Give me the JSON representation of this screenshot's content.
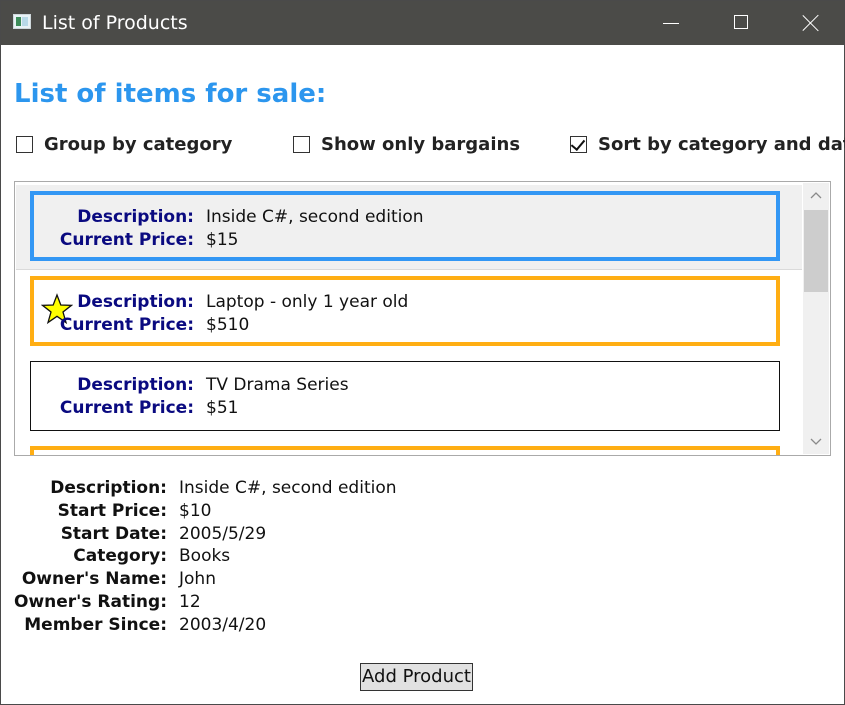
{
  "window": {
    "title": "List of Products",
    "app_icon": "window-app-icon",
    "controls": {
      "minimize": "minimize-icon",
      "maximize": "maximize-icon",
      "close": "close-icon"
    }
  },
  "heading": "List of items for sale:",
  "options": {
    "group_by_category": {
      "label": "Group by category",
      "checked": false
    },
    "show_only_bargains": {
      "label": "Show only bargains",
      "checked": false
    },
    "sort_by_category_date": {
      "label": "Sort by category and date",
      "checked": true
    }
  },
  "list": {
    "description_label": "Description:",
    "price_label": "Current Price:",
    "items": [
      {
        "description": "Inside C#, second edition",
        "price": "$15",
        "style": "selected",
        "bargain": false
      },
      {
        "description": "Laptop - only 1 year old",
        "price": "$510",
        "style": "bargain",
        "bargain": true
      },
      {
        "description": "TV Drama Series",
        "price": "$51",
        "style": "normal",
        "bargain": false
      },
      {
        "description": "",
        "price": "",
        "style": "bargain",
        "bargain": true
      }
    ]
  },
  "details": {
    "rows": [
      {
        "label": "Description:",
        "value": "Inside C#, second edition"
      },
      {
        "label": "Start Price:",
        "value": "$10"
      },
      {
        "label": "Start Date:",
        "value": "2005/5/29"
      },
      {
        "label": "Category:",
        "value": "Books"
      },
      {
        "label": "Owner's Name:",
        "value": "John"
      },
      {
        "label": "Owner's Rating:",
        "value": "12"
      },
      {
        "label": "Member Since:",
        "value": "2003/4/20"
      }
    ]
  },
  "add_button": "Add Product",
  "colors": {
    "heading": "#2c96ee",
    "selected_border": "#3397f4",
    "bargain_border": "#ffae13",
    "field_label": "#0a0a80",
    "star_fill": "#ffff00"
  }
}
